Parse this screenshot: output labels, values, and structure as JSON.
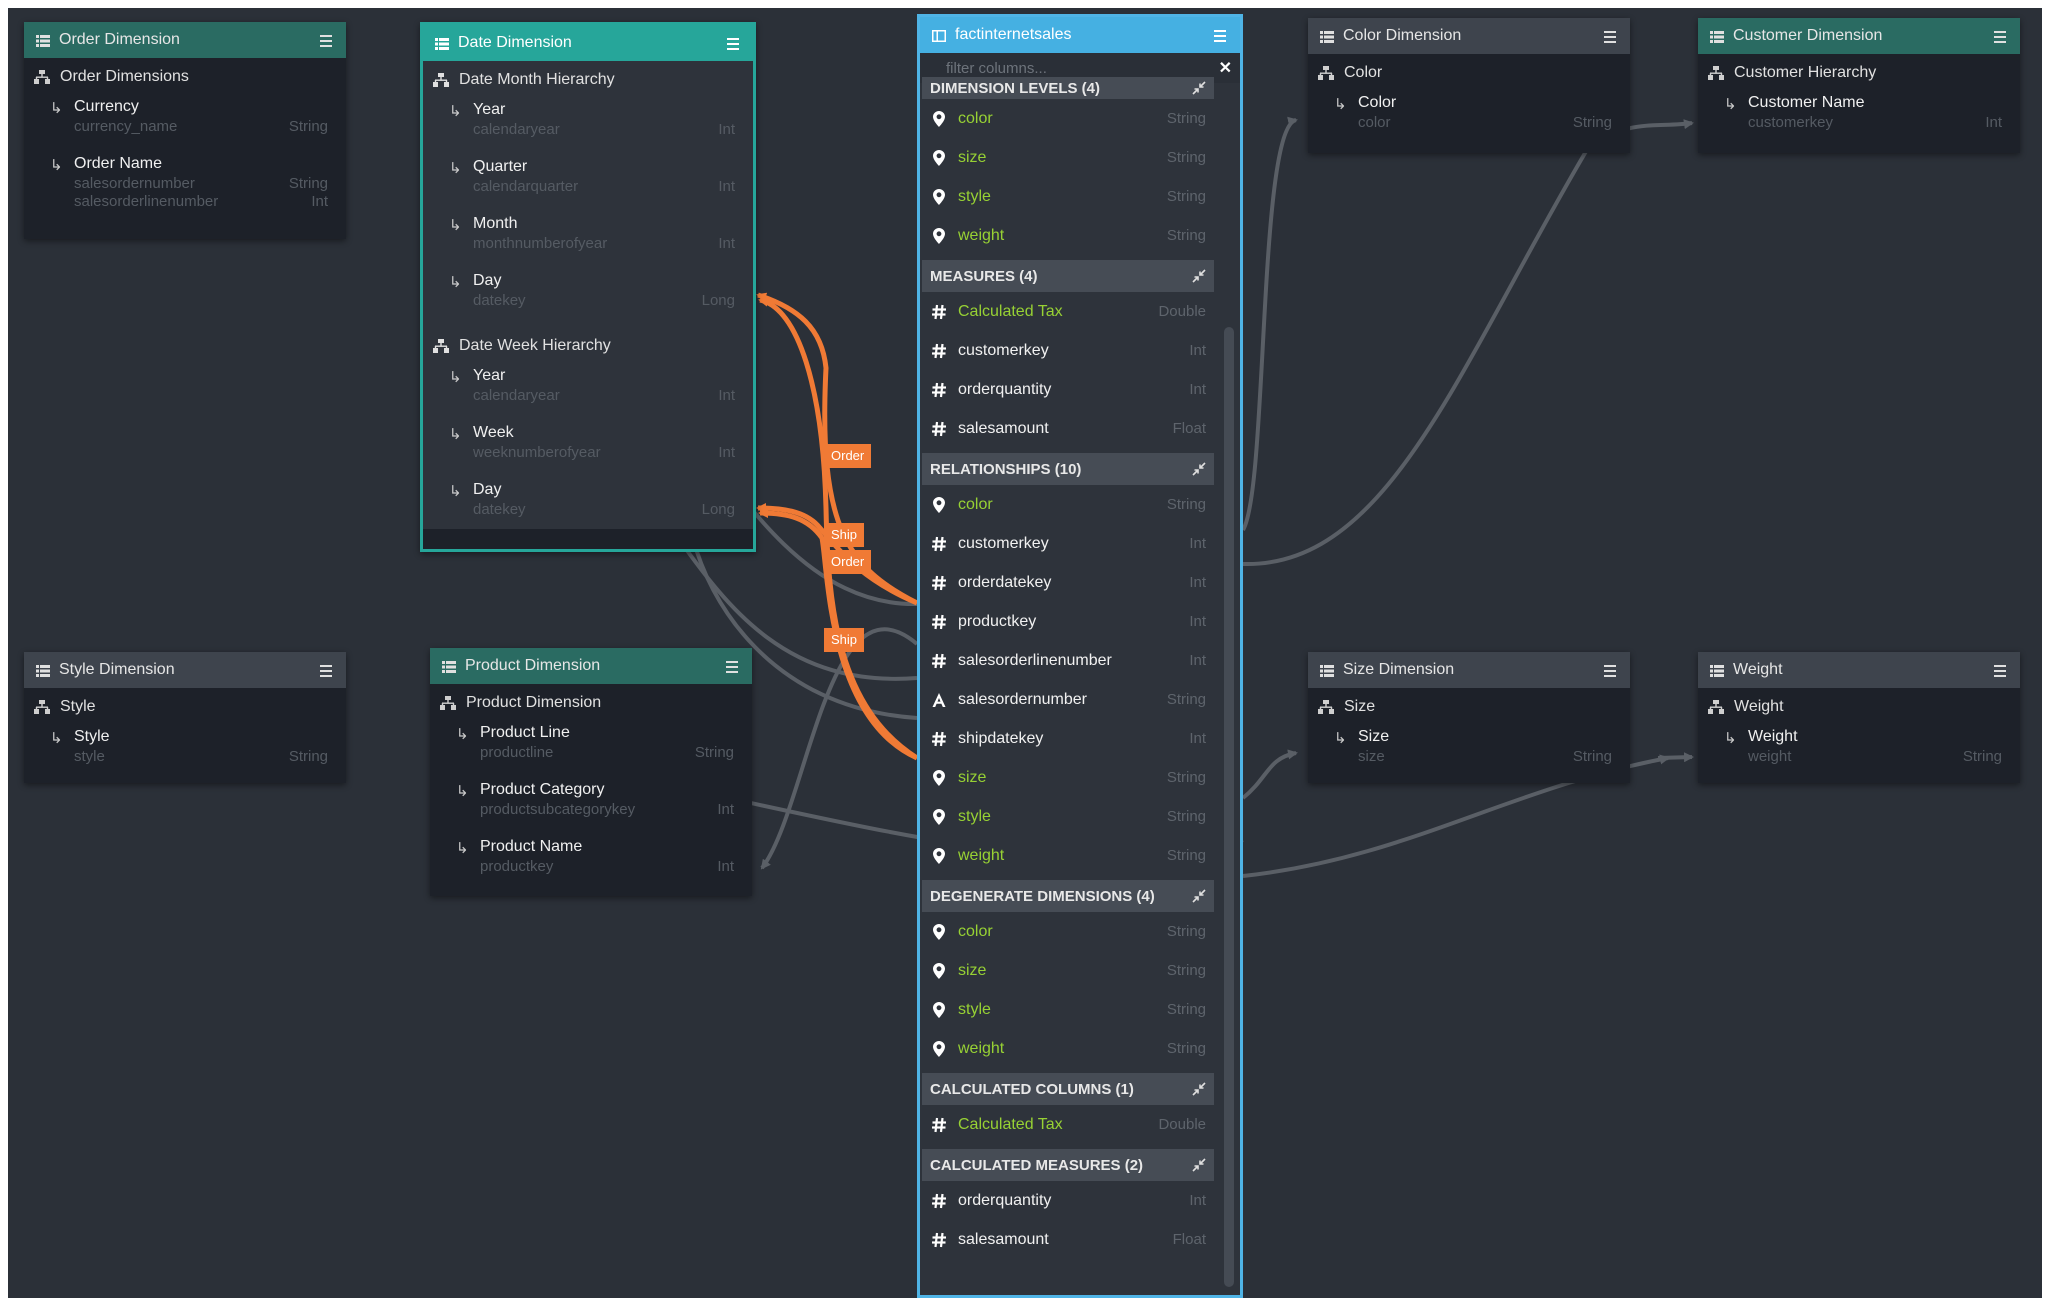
{
  "filter": {
    "placeholder": "filter columns..."
  },
  "orderDimension": {
    "title": "Order Dimension",
    "hierarchy": "Order Dimensions",
    "levels": [
      {
        "name": "Currency",
        "cols": [
          "currency_name"
        ],
        "types": [
          "String"
        ]
      },
      {
        "name": "Order Name",
        "cols": [
          "salesordernumber",
          "salesorderlinenumber"
        ],
        "types": [
          "String",
          "Int"
        ]
      }
    ]
  },
  "dateDimension": {
    "title": "Date Dimension",
    "hierarchies": [
      {
        "name": "Date Month Hierarchy",
        "levels": [
          {
            "name": "Year",
            "col": "calendaryear",
            "type": "Int"
          },
          {
            "name": "Quarter",
            "col": "calendarquarter",
            "type": "Int"
          },
          {
            "name": "Month",
            "col": "monthnumberofyear",
            "type": "Int"
          },
          {
            "name": "Day",
            "col": "datekey",
            "type": "Long"
          }
        ]
      },
      {
        "name": "Date Week Hierarchy",
        "levels": [
          {
            "name": "Year",
            "col": "calendaryear",
            "type": "Int"
          },
          {
            "name": "Week",
            "col": "weeknumberofyear",
            "type": "Int"
          },
          {
            "name": "Day",
            "col": "datekey",
            "type": "Long"
          }
        ]
      }
    ]
  },
  "styleDimension": {
    "title": "Style Dimension",
    "hierarchy": "Style",
    "levels": [
      {
        "name": "Style",
        "col": "style",
        "type": "String"
      }
    ]
  },
  "productDimension": {
    "title": "Product Dimension",
    "hierarchy": "Product Dimension",
    "levels": [
      {
        "name": "Product Line",
        "col": "productline",
        "type": "String"
      },
      {
        "name": "Product Category",
        "col": "productsubcategorykey",
        "type": "Int"
      },
      {
        "name": "Product Name",
        "col": "productkey",
        "type": "Int"
      }
    ]
  },
  "colorDimension": {
    "title": "Color Dimension",
    "hierarchy": "Color",
    "levels": [
      {
        "name": "Color",
        "col": "color",
        "type": "String"
      }
    ]
  },
  "customerDimension": {
    "title": "Customer Dimension",
    "hierarchy": "Customer Hierarchy",
    "levels": [
      {
        "name": "Customer Name",
        "col": "customerkey",
        "type": "Int"
      }
    ]
  },
  "sizeDimension": {
    "title": "Size Dimension",
    "hierarchy": "Size",
    "levels": [
      {
        "name": "Size",
        "col": "size",
        "type": "String"
      }
    ]
  },
  "weightDimension": {
    "title": "Weight",
    "hierarchy": "Weight",
    "levels": [
      {
        "name": "Weight",
        "col": "weight",
        "type": "String"
      }
    ]
  },
  "fact": {
    "title": "factinternetsales",
    "sections": {
      "dimensionLevels": {
        "title": "DIMENSION LEVELS (4)",
        "rows": [
          {
            "name": "color",
            "type": "String",
            "icon": "pin",
            "style": "green"
          },
          {
            "name": "size",
            "type": "String",
            "icon": "pin",
            "style": "green"
          },
          {
            "name": "style",
            "type": "String",
            "icon": "pin",
            "style": "green"
          },
          {
            "name": "weight",
            "type": "String",
            "icon": "pin",
            "style": "green"
          }
        ]
      },
      "measures": {
        "title": "MEASURES (4)",
        "rows": [
          {
            "name": "Calculated Tax",
            "type": "Double",
            "icon": "hash",
            "style": "green"
          },
          {
            "name": "customerkey",
            "type": "Int",
            "icon": "hash",
            "style": "white"
          },
          {
            "name": "orderquantity",
            "type": "Int",
            "icon": "hash",
            "style": "white"
          },
          {
            "name": "salesamount",
            "type": "Float",
            "icon": "hash",
            "style": "white"
          }
        ]
      },
      "relationships": {
        "title": "RELATIONSHIPS (10)",
        "rows": [
          {
            "name": "color",
            "type": "String",
            "icon": "pin",
            "style": "green"
          },
          {
            "name": "customerkey",
            "type": "Int",
            "icon": "hash",
            "style": "white"
          },
          {
            "name": "orderdatekey",
            "type": "Int",
            "icon": "hash",
            "style": "white"
          },
          {
            "name": "productkey",
            "type": "Int",
            "icon": "hash",
            "style": "white"
          },
          {
            "name": "salesorderlinenumber",
            "type": "Int",
            "icon": "hash",
            "style": "white"
          },
          {
            "name": "salesordernumber",
            "type": "String",
            "icon": "text",
            "style": "white"
          },
          {
            "name": "shipdatekey",
            "type": "Int",
            "icon": "hash",
            "style": "white"
          },
          {
            "name": "size",
            "type": "String",
            "icon": "pin",
            "style": "green"
          },
          {
            "name": "style",
            "type": "String",
            "icon": "pin",
            "style": "green"
          },
          {
            "name": "weight",
            "type": "String",
            "icon": "pin",
            "style": "green"
          }
        ]
      },
      "degenerate": {
        "title": "DEGENERATE DIMENSIONS (4)",
        "rows": [
          {
            "name": "color",
            "type": "String",
            "icon": "pin",
            "style": "green"
          },
          {
            "name": "size",
            "type": "String",
            "icon": "pin",
            "style": "green"
          },
          {
            "name": "style",
            "type": "String",
            "icon": "pin",
            "style": "green"
          },
          {
            "name": "weight",
            "type": "String",
            "icon": "pin",
            "style": "green"
          }
        ]
      },
      "calcColumns": {
        "title": "CALCULATED COLUMNS (1)",
        "rows": [
          {
            "name": "Calculated Tax",
            "type": "Double",
            "icon": "hash",
            "style": "green"
          }
        ]
      },
      "calcMeasures": {
        "title": "CALCULATED MEASURES (2)",
        "rows": [
          {
            "name": "orderquantity",
            "type": "Int",
            "icon": "hash",
            "style": "white"
          },
          {
            "name": "salesamount",
            "type": "Float",
            "icon": "hash",
            "style": "white"
          }
        ]
      }
    }
  },
  "badges": {
    "order1": "Order",
    "ship1": "Ship",
    "order2": "Order",
    "ship2": "Ship"
  },
  "colors": {
    "canvas": "#2b3038",
    "wire": "#5a5f66",
    "highlight": "#f07a35",
    "factBorder": "#4fb4e6",
    "accentGreen": "#97d134"
  }
}
